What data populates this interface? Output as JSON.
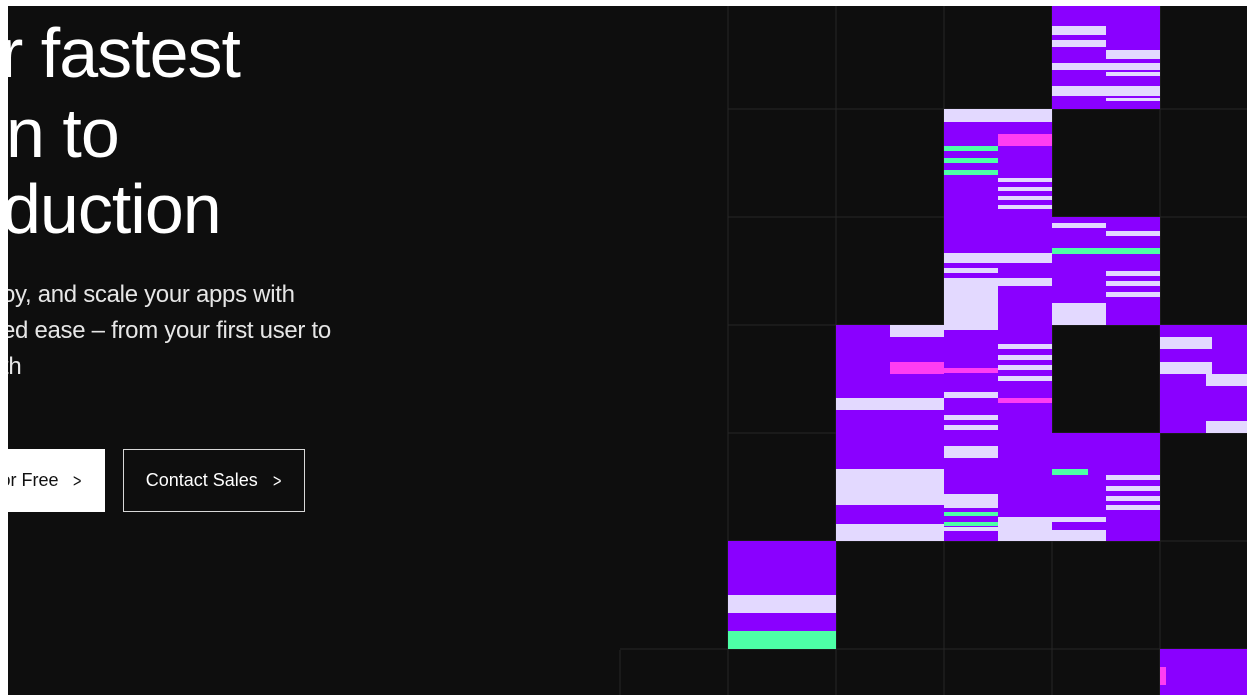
{
  "hero": {
    "line1": "r fastest",
    "line2": "n to",
    "line3": "duction",
    "sub1": "oy, and scale your apps with",
    "sub2": "ed ease – from your first user to",
    "sub3": "th"
  },
  "actions": {
    "primary_label": "or Free",
    "secondary_label": "Contact Sales"
  },
  "icons": {
    "primary_chevron": "chevron-right-icon",
    "secondary_chevron": "chevron-right-icon"
  },
  "colors": {
    "background": "#0e0e0e",
    "grid_line": "#262626",
    "purple": "#8a00ff",
    "lavender": "#e3d9ff",
    "mint": "#4dffa6",
    "magenta": "#ff3df2"
  }
}
